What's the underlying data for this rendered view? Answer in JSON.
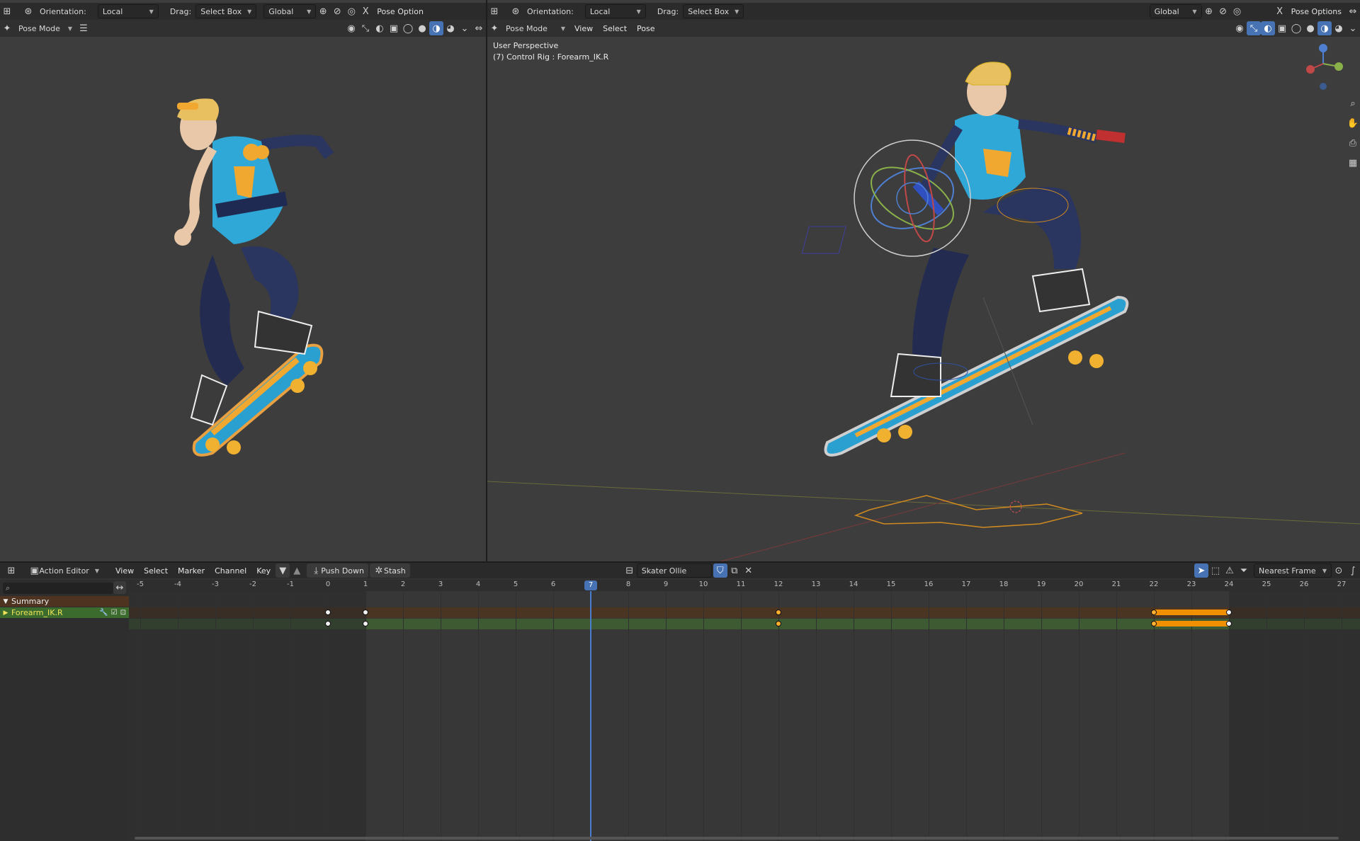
{
  "left_viewport": {
    "orientation_label": "Orientation:",
    "orientation_value": "Local",
    "drag_label": "Drag:",
    "drag_value": "Select Box",
    "transform_value": "Global",
    "pose_options": "Pose Option",
    "mode": "Pose Mode"
  },
  "right_viewport": {
    "orientation_label": "Orientation:",
    "orientation_value": "Local",
    "drag_label": "Drag:",
    "drag_value": "Select Box",
    "transform_value": "Global",
    "pose_options": "Pose Options",
    "mode": "Pose Mode",
    "menus": [
      "View",
      "Select",
      "Pose"
    ],
    "overlay_line1": "User Perspective",
    "overlay_line2": "(7) Control Rig : Forearm_IK.R"
  },
  "action_editor": {
    "editor_mode": "Action Editor",
    "menus": [
      "View",
      "Select",
      "Marker",
      "Channel",
      "Key"
    ],
    "push_down": "Push Down",
    "stash": "Stash",
    "action_name": "Skater Ollie",
    "snapping": "Nearest Frame",
    "channels": [
      "Summary",
      "Forearm_IK.R"
    ],
    "current_frame": 7,
    "frame_ticks": [
      -5,
      -4,
      -3,
      -2,
      -1,
      0,
      1,
      2,
      3,
      4,
      5,
      6,
      7,
      8,
      9,
      10,
      11,
      12,
      13,
      14,
      15,
      16,
      17,
      18,
      19,
      20,
      21,
      22,
      23,
      24,
      25,
      26,
      27
    ],
    "scene_start": 1,
    "scene_end": 24,
    "keyframes": [
      {
        "frame": 0,
        "selected": false
      },
      {
        "frame": 1,
        "selected": false
      },
      {
        "frame": 12,
        "selected": true
      },
      {
        "frame": 22,
        "selected": true
      },
      {
        "frame": 24,
        "selected": false
      }
    ],
    "holds": [
      {
        "from": 22,
        "to": 24
      }
    ]
  }
}
